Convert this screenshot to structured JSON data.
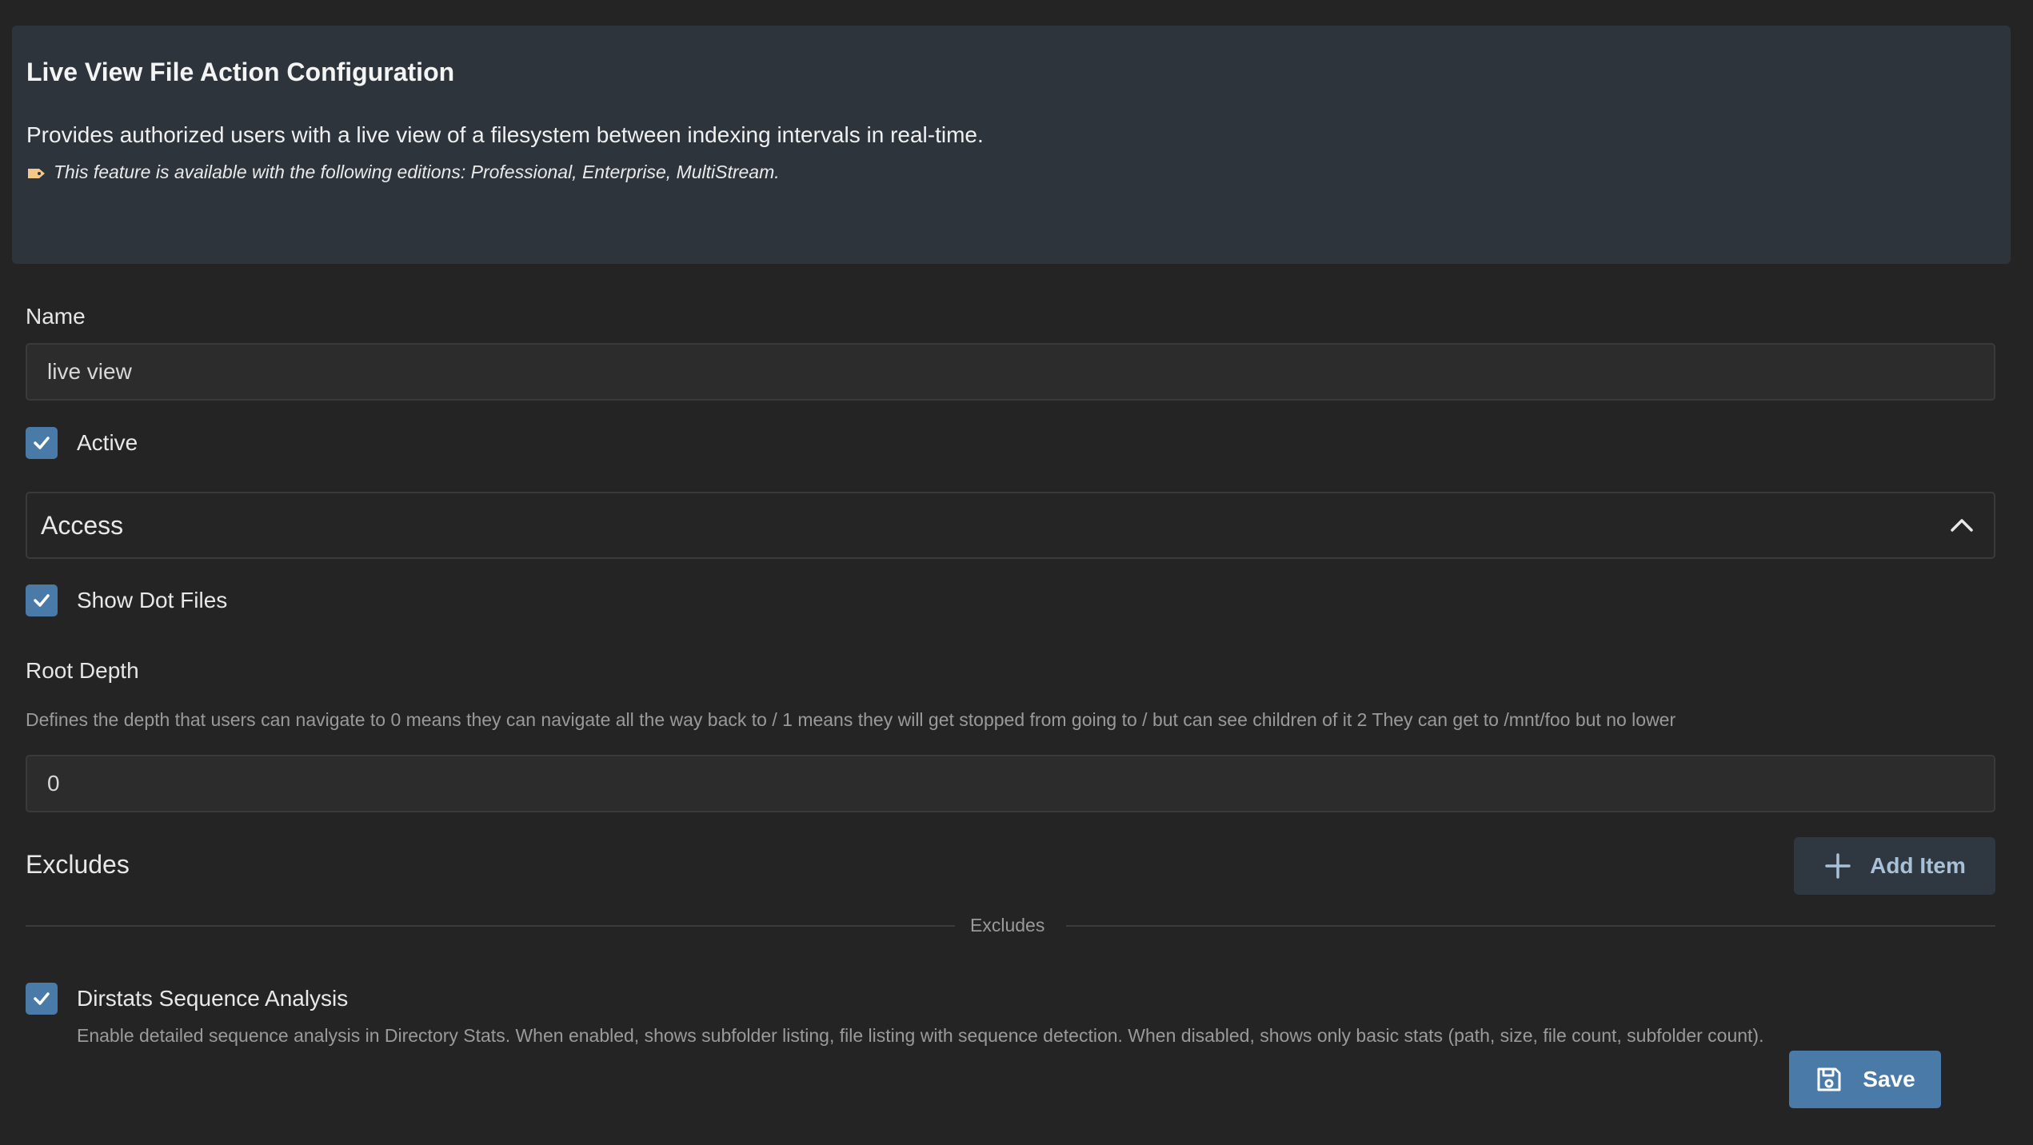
{
  "banner": {
    "title": "Live View File Action Configuration",
    "description": "Provides authorized users with a live view of a filesystem between indexing intervals in real-time.",
    "editions_note": "This feature is available with the following editions: Professional, Enterprise, MultiStream.",
    "note_icon": "tag-icon"
  },
  "name_field": {
    "label": "Name",
    "value": "live view"
  },
  "active": {
    "label": "Active",
    "checked": true
  },
  "access": {
    "title": "Access",
    "expanded": true,
    "icon": "chevron-up-icon"
  },
  "show_dot_files": {
    "label": "Show Dot Files",
    "checked": true
  },
  "root_depth": {
    "label": "Root Depth",
    "help": "Defines the depth that users can navigate to 0 means they can navigate all the way back to / 1 means they will get stopped from going to / but can see children of it 2 They can get to /mnt/foo but no lower",
    "value": "0"
  },
  "excludes": {
    "title": "Excludes",
    "add_button_label": "Add Item",
    "divider_label": "Excludes"
  },
  "dirstats": {
    "label": "Dirstats Sequence Analysis",
    "checked": true,
    "description": "Enable detailed sequence analysis in Directory Stats. When enabled, shows subfolder listing, file listing with sequence detection. When disabled, shows only basic stats (path, size, file count, subfolder count)."
  },
  "save_button_label": "Save",
  "colors": {
    "background": "#242424",
    "banner": "#2d343c",
    "accent": "#4a7aa8"
  }
}
